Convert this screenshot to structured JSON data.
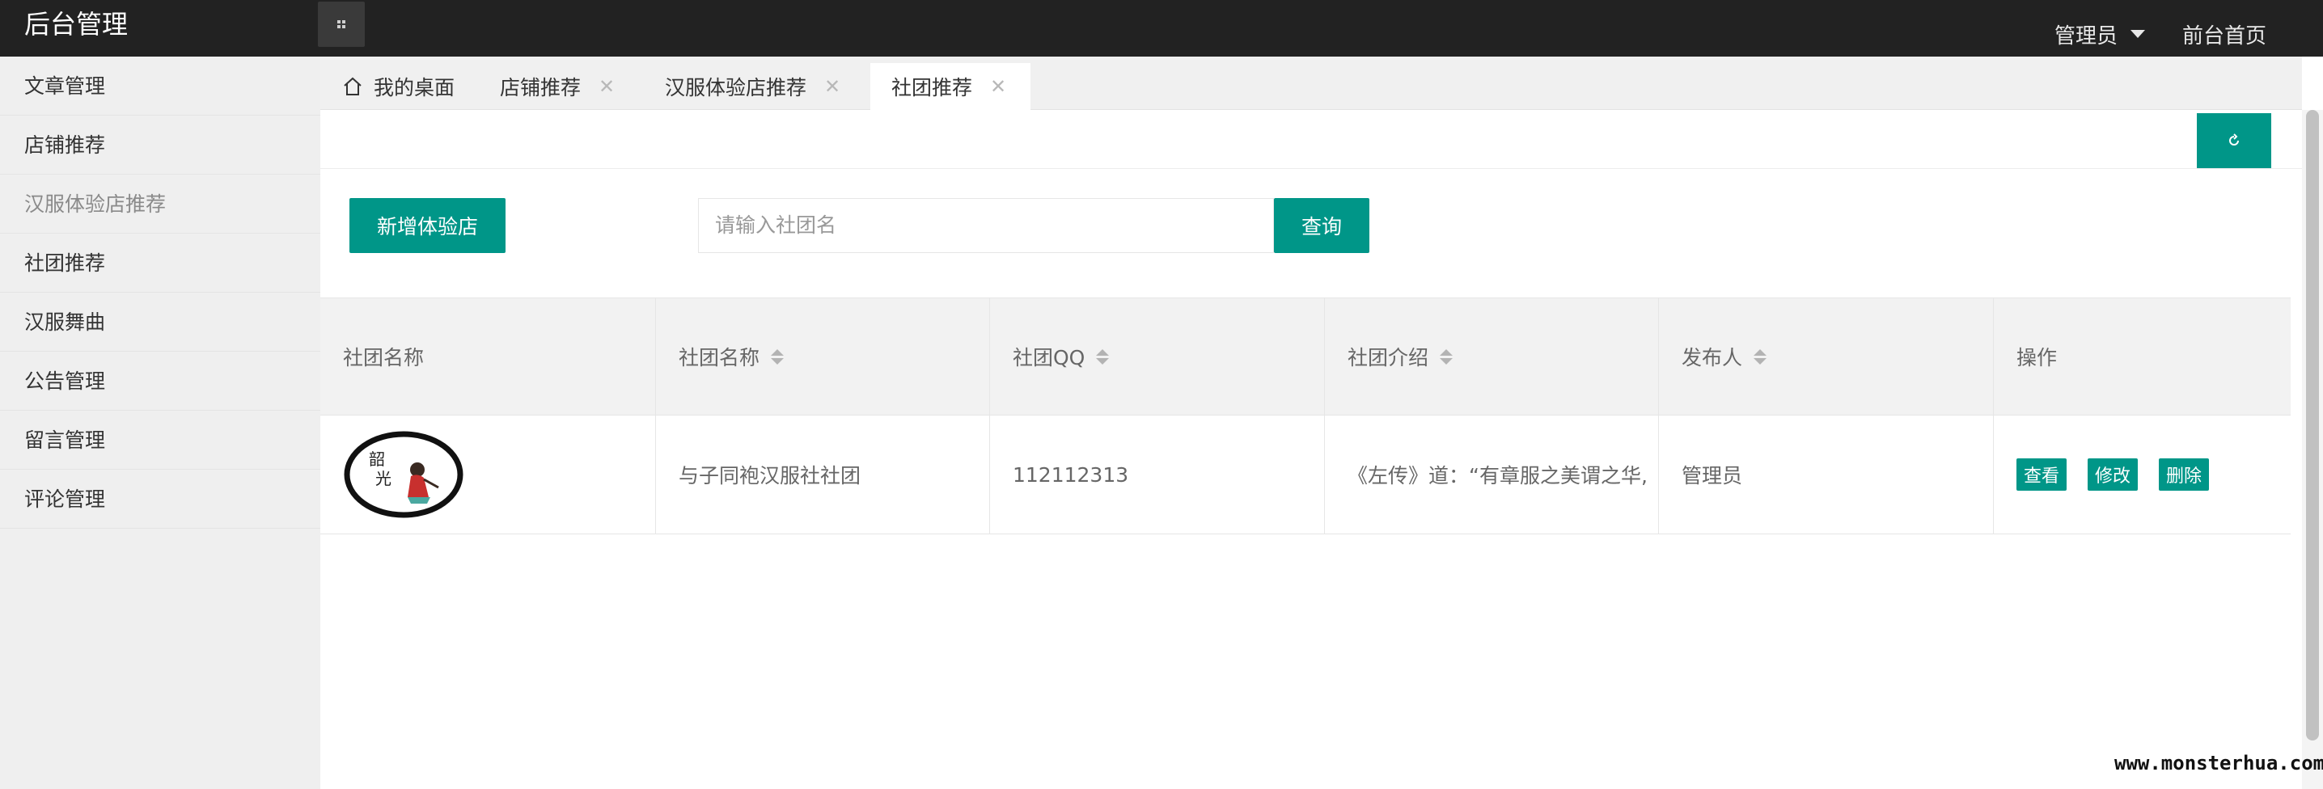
{
  "header": {
    "brand": "后台管理",
    "toggle_icon": "grid-toggle-icon",
    "user_menu_label": "管理员",
    "front_home_label": "前台首页"
  },
  "sidebar": {
    "items": [
      {
        "label": "文章管理"
      },
      {
        "label": "店铺推荐"
      },
      {
        "label": "汉服体验店推荐"
      },
      {
        "label": "社团推荐"
      },
      {
        "label": "汉服舞曲"
      },
      {
        "label": "公告管理"
      },
      {
        "label": "留言管理"
      },
      {
        "label": "评论管理"
      }
    ]
  },
  "tabs": [
    {
      "label": "我的桌面",
      "icon": "home-icon",
      "closable": false
    },
    {
      "label": "店铺推荐",
      "closable": true
    },
    {
      "label": "汉服体验店推荐",
      "closable": true
    },
    {
      "label": "社团推荐",
      "closable": true,
      "active": true
    }
  ],
  "toolbar": {
    "add_label": "新增体验店",
    "search_placeholder": "请输入社团名",
    "search_button": "查询",
    "refresh_icon": "refresh-icon"
  },
  "table": {
    "columns": [
      "社团名称",
      "社团名称",
      "社团QQ",
      "社团介绍",
      "发布人",
      "操作"
    ],
    "rows": [
      {
        "image": "club-logo-image",
        "name": "与子同袍汉服社社团",
        "qq": "112112313",
        "intro": "《左传》道：“有章服之美谓之华,",
        "publisher": "管理员",
        "actions": [
          "查看",
          "修改",
          "删除"
        ]
      }
    ]
  },
  "watermark": "www.monsterhua.com",
  "colors": {
    "accent": "#009688",
    "header_bg": "#222222",
    "sidebar_bg": "#efefef"
  }
}
